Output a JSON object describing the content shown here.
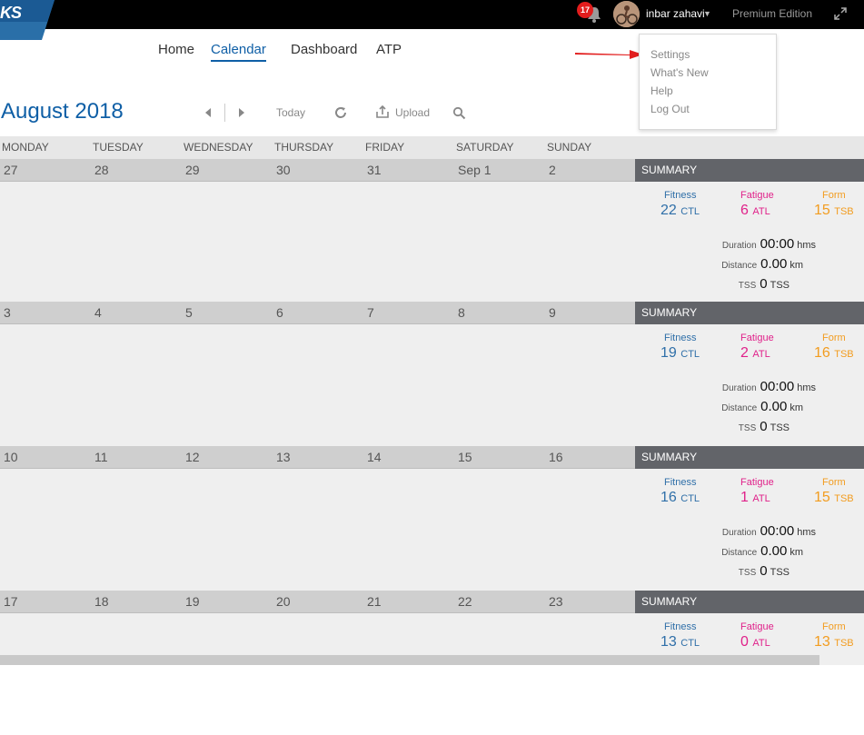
{
  "header": {
    "logo_text": "KS",
    "notification_count": "17",
    "username": "inbar zahavi",
    "edition": "Premium Edition"
  },
  "nav": {
    "items": [
      {
        "label": "Home"
      },
      {
        "label": "Calendar",
        "active": true
      },
      {
        "label": "Dashboard"
      },
      {
        "label": "ATP"
      }
    ]
  },
  "user_menu": {
    "items": [
      "Settings",
      "What's New",
      "Help",
      "Log Out"
    ]
  },
  "calendar": {
    "month": "August",
    "year": "2018",
    "toolbar": {
      "today": "Today",
      "upload": "Upload"
    },
    "days_of_week": [
      "MONDAY",
      "TUESDAY",
      "WEDNESDAY",
      "THURSDAY",
      "FRIDAY",
      "SATURDAY",
      "SUNDAY"
    ],
    "summary_label": "SUMMARY",
    "labels": {
      "fitness": "Fitness",
      "fatigue": "Fatigue",
      "form": "Form",
      "ctl": "CTL",
      "atl": "ATL",
      "tsb": "TSB",
      "duration": "Duration",
      "distance": "Distance",
      "tss": "TSS",
      "hms": "hms",
      "km": "km"
    },
    "weeks": [
      {
        "dates": [
          "27",
          "28",
          "29",
          "30",
          "31",
          "Sep 1",
          "2"
        ],
        "fitness": "22",
        "fatigue": "6",
        "form": "15",
        "duration": "00:00",
        "distance": "0.00",
        "tss": "0"
      },
      {
        "dates": [
          "3",
          "4",
          "5",
          "6",
          "7",
          "8",
          "9"
        ],
        "fitness": "19",
        "fatigue": "2",
        "form": "16",
        "duration": "00:00",
        "distance": "0.00",
        "tss": "0"
      },
      {
        "dates": [
          "10",
          "11",
          "12",
          "13",
          "14",
          "15",
          "16"
        ],
        "fitness": "16",
        "fatigue": "1",
        "form": "15",
        "duration": "00:00",
        "distance": "0.00",
        "tss": "0"
      },
      {
        "dates": [
          "17",
          "18",
          "19",
          "20",
          "21",
          "22",
          "23"
        ],
        "fitness": "13",
        "fatigue": "0",
        "form": "13"
      }
    ]
  },
  "colors": {
    "accent": "#0f5fa6",
    "fitness": "#2f6fa8",
    "fatigue": "#e0218a",
    "form": "#f29c1f",
    "summary_header": "#626469",
    "topbar": "#000000"
  }
}
